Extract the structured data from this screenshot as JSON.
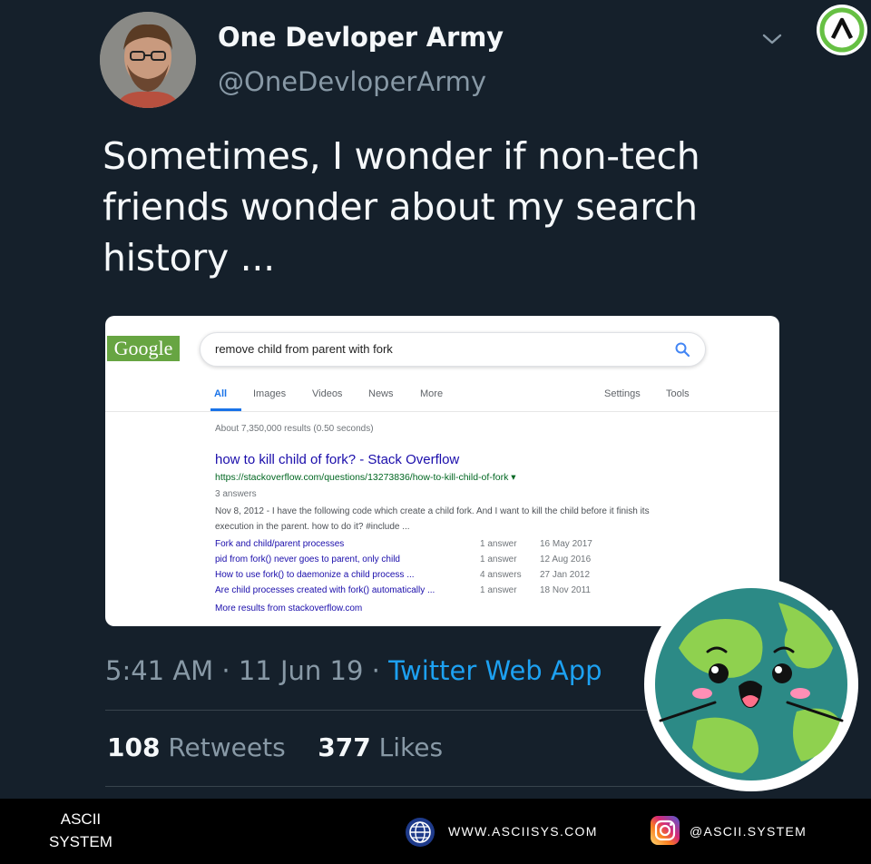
{
  "author": {
    "name": "One Devloper Army",
    "handle": "@OneDevloperArmy"
  },
  "tweet": {
    "text": "Sometimes, I wonder if non-tech friends wonder about my search history ...",
    "time": "5:41 AM",
    "date": "11 Jun 19",
    "source": "Twitter Web App",
    "separator": "·",
    "retweets_count": "108",
    "retweets_label": "Retweets",
    "likes_count": "377",
    "likes_label": "Likes"
  },
  "google": {
    "logo": "Google",
    "query": "remove child from parent with fork",
    "tabs": [
      "All",
      "Images",
      "Videos",
      "News",
      "More",
      "Settings",
      "Tools"
    ],
    "stats": "About 7,350,000 results (0.50 seconds)",
    "result": {
      "title": "how to kill child of fork? - Stack Overflow",
      "url": "https://stackoverflow.com/questions/13273836/how-to-kill-child-of-fork ▾",
      "meta": "3 answers",
      "snippet": "Nov 8, 2012 - I have the following code which create a child fork. And I want to kill the child before it finish its execution in the parent. how to do it? #include ..."
    },
    "sub_results": [
      {
        "title": "Fork and child/parent processes",
        "answers": "1 answer",
        "date": "16 May 2017"
      },
      {
        "title": "pid from fork() never goes to parent, only child",
        "answers": "1 answer",
        "date": "12 Aug 2016"
      },
      {
        "title": "How to use fork() to daemonize a child process ...",
        "answers": "4 answers",
        "date": "27 Jan 2012"
      },
      {
        "title": "Are child processes created with fork() automatically ...",
        "answers": "1 answer",
        "date": "18 Nov 2011"
      }
    ],
    "more_results": "More results from stackoverflow.com"
  },
  "footer": {
    "brand_line1": "ASCII",
    "brand_line2": "SYSTEM",
    "website": "WWW.ASCIISYS.COM",
    "instagram": "@ASCII.SYSTEM"
  },
  "colors": {
    "background": "#15202b",
    "accent": "#1da1f2",
    "muted": "#8899a6",
    "brand_green": "#67a542"
  },
  "icons": [
    "chevron-down-icon",
    "brand-logo-icon",
    "search-icon",
    "globe-icon",
    "instagram-icon",
    "earth-sticker"
  ]
}
